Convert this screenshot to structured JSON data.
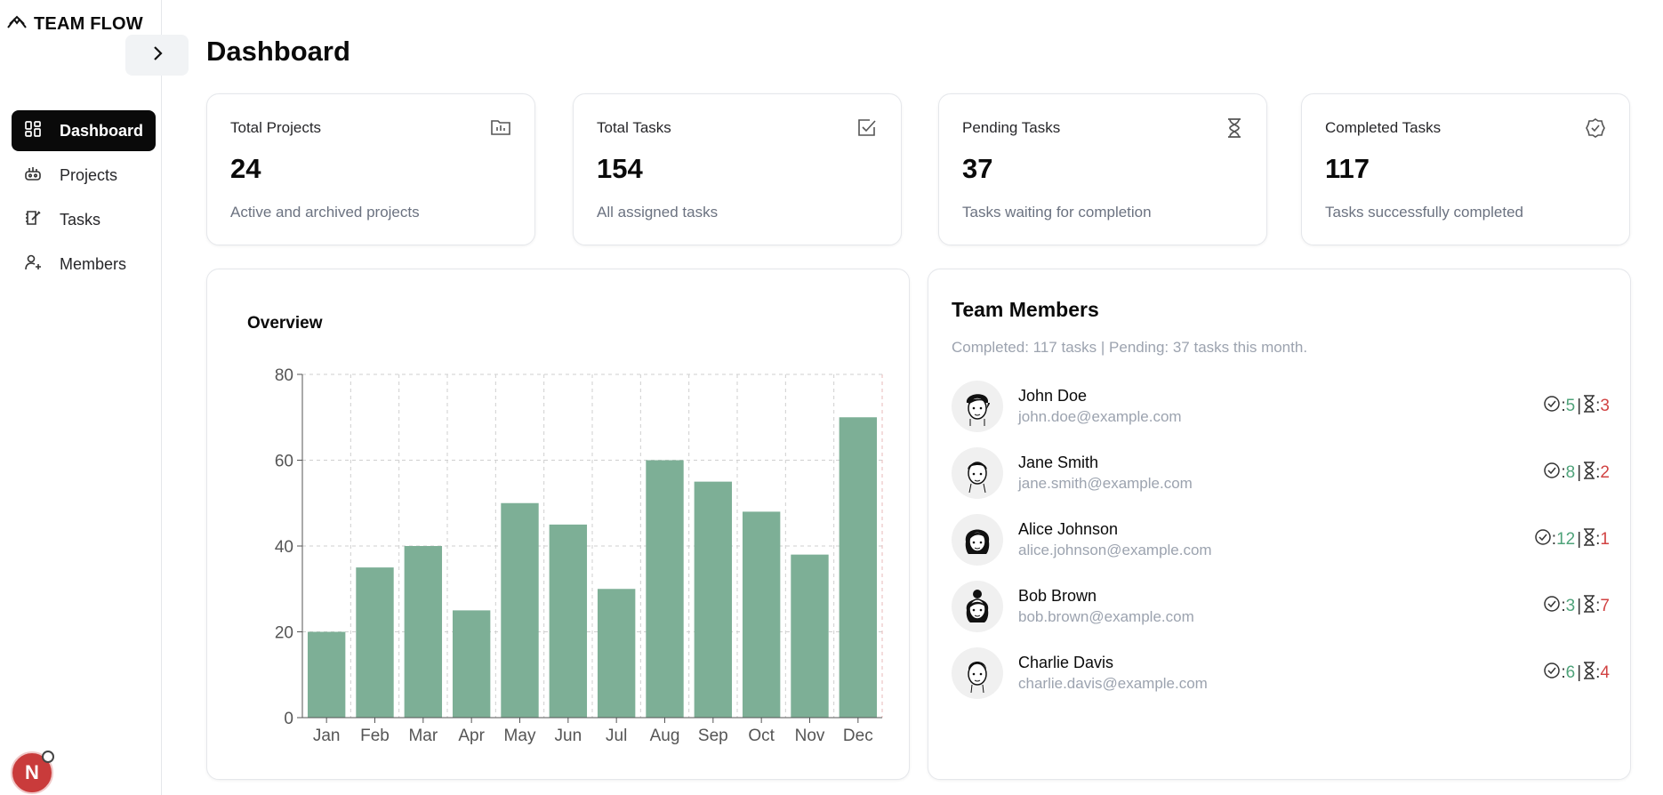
{
  "brand": {
    "name": "TEAM FLOW",
    "icon": "mountain-logo-icon"
  },
  "sidebar": {
    "items": [
      {
        "label": "Dashboard",
        "icon": "dashboard-icon",
        "active": true
      },
      {
        "label": "Projects",
        "icon": "projects-icon",
        "active": false
      },
      {
        "label": "Tasks",
        "icon": "tasks-icon",
        "active": false
      },
      {
        "label": "Members",
        "icon": "add-user-icon",
        "active": false
      }
    ],
    "user_initial": "N"
  },
  "page": {
    "title": "Dashboard"
  },
  "stats": [
    {
      "label": "Total Projects",
      "value": "24",
      "desc": "Active and archived projects",
      "icon": "folder-icon"
    },
    {
      "label": "Total Tasks",
      "value": "154",
      "desc": "All assigned tasks",
      "icon": "checkbox-icon"
    },
    {
      "label": "Pending Tasks",
      "value": "37",
      "desc": "Tasks waiting for completion",
      "icon": "hourglass-icon"
    },
    {
      "label": "Completed Tasks",
      "value": "117",
      "desc": "Tasks successfully completed",
      "icon": "badge-check-icon"
    }
  ],
  "overview": {
    "title": "Overview"
  },
  "chart_data": {
    "type": "bar",
    "categories": [
      "Jan",
      "Feb",
      "Mar",
      "Apr",
      "May",
      "Jun",
      "Jul",
      "Aug",
      "Sep",
      "Oct",
      "Nov",
      "Dec"
    ],
    "values": [
      20,
      35,
      40,
      25,
      50,
      45,
      30,
      60,
      55,
      48,
      38,
      70
    ],
    "ylim": [
      0,
      80
    ],
    "yticks": [
      "0",
      "20",
      "40",
      "60",
      "80"
    ],
    "grid": true,
    "bar_color": "#7daf96"
  },
  "members": {
    "title": "Team Members",
    "subtitle": "Completed: 117 tasks | Pending: 37 tasks this month.",
    "list": [
      {
        "name": "John Doe",
        "email": "john.doe@example.com",
        "completed": "5",
        "pending": "3"
      },
      {
        "name": "Jane Smith",
        "email": "jane.smith@example.com",
        "completed": "8",
        "pending": "2"
      },
      {
        "name": "Alice Johnson",
        "email": "alice.johnson@example.com",
        "completed": "12",
        "pending": "1"
      },
      {
        "name": "Bob Brown",
        "email": "bob.brown@example.com",
        "completed": "3",
        "pending": "7"
      },
      {
        "name": "Charlie Davis",
        "email": "charlie.davis@example.com",
        "completed": "6",
        "pending": "4"
      }
    ]
  },
  "colors": {
    "completed": "#4fa37a",
    "pending": "#d14343",
    "accent": "#0a0a0a"
  }
}
